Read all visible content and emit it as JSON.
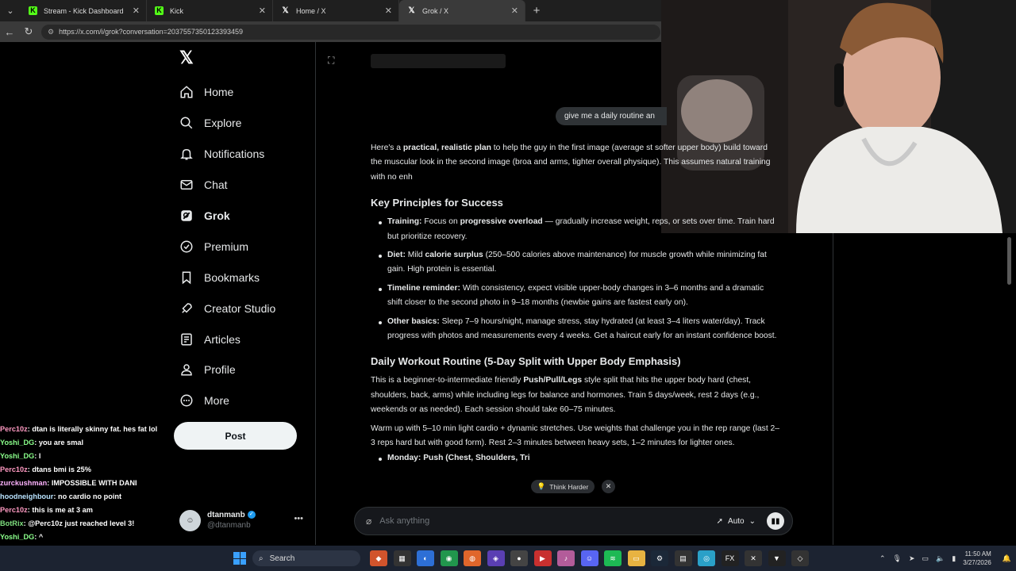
{
  "browser": {
    "tabs": [
      {
        "label": "Stream - Kick Dashboard",
        "icon": "kick-icon",
        "active": false
      },
      {
        "label": "Kick",
        "icon": "kick-icon",
        "active": false
      },
      {
        "label": "Home / X",
        "icon": "x-icon",
        "active": false
      },
      {
        "label": "Grok / X",
        "icon": "x-icon",
        "active": true
      }
    ],
    "url": "https://x.com/i/grok?conversation=2037557350123393459"
  },
  "sidebar": {
    "items": [
      {
        "label": "Home",
        "icon": "home-icon"
      },
      {
        "label": "Explore",
        "icon": "search-icon"
      },
      {
        "label": "Notifications",
        "icon": "bell-icon"
      },
      {
        "label": "Chat",
        "icon": "mail-icon"
      },
      {
        "label": "Grok",
        "icon": "grok-icon",
        "active": true
      },
      {
        "label": "Premium",
        "icon": "verified-icon"
      },
      {
        "label": "Bookmarks",
        "icon": "bookmark-icon"
      },
      {
        "label": "Creator Studio",
        "icon": "rocket-icon"
      },
      {
        "label": "Articles",
        "icon": "article-icon"
      },
      {
        "label": "Profile",
        "icon": "person-icon"
      },
      {
        "label": "More",
        "icon": "more-circle-icon"
      }
    ],
    "post_label": "Post",
    "profile": {
      "display_name": "dtanmanb",
      "handle": "@dtanmanb"
    }
  },
  "chat": [
    {
      "user": "Perc10z",
      "msg": ": dtan is literally skinny fat. hes fat lol"
    },
    {
      "user": "Yoshi_DG",
      "msg": ": you are smal"
    },
    {
      "user": "Yoshi_DG",
      "msg": ": l"
    },
    {
      "user": "Perc10z",
      "msg": ": dtans bmi is 25%"
    },
    {
      "user": "zurckushman",
      "msg": ": IMPOSSIBLE WITH DANI"
    },
    {
      "user": "hoodneighbour",
      "msg": ": no cardio no point"
    },
    {
      "user": "Perc10z",
      "msg": ": this is me at 3 am"
    },
    {
      "user": "BotRix",
      "msg": ": @Perc10z just reached level 3!"
    },
    {
      "user": "Yoshi_DG",
      "msg": ": ^"
    }
  ],
  "grok": {
    "user_message": "give me a daily routine an",
    "intro": {
      "pre": "Here's a ",
      "bold": "practical, realistic plan",
      "post": " to help the guy in the first image (average st softer upper body) build toward the muscular look in the second image (broa and arms, tighter overall physique). This assumes natural training with no enh"
    },
    "h1": "Key Principles for Success",
    "principles": [
      {
        "label": "Training:",
        "text1": " Focus on ",
        "bold2": "progressive overload",
        "text2": " — gradually increase weight, reps, or sets over time. Train hard but prioritize recovery."
      },
      {
        "label": "Diet:",
        "text1": " Mild ",
        "bold2": "calorie surplus",
        "text2": " (250–500 calories above maintenance) for muscle growth while minimizing fat gain. High protein is essential."
      },
      {
        "label": "Timeline reminder:",
        "text1": " With consistency, expect visible upper-body changes in 3–6 months and a dramatic shift closer to the second photo in 9–18 months (newbie gains are fastest early on).",
        "bold2": "",
        "text2": ""
      },
      {
        "label": "Other basics:",
        "text1": " Sleep 7–9 hours/night, manage stress, stay hydrated (at least 3–4 liters water/day). Track progress with photos and measurements every 4 weeks. Get a haircut early for an instant confidence boost.",
        "bold2": "",
        "text2": ""
      }
    ],
    "h2": "Daily Workout Routine (5-Day Split with Upper Body Emphasis)",
    "p1": {
      "pre": "This is a beginner-to-intermediate friendly ",
      "bold": "Push/Pull/Legs",
      "post": " style split that hits the upper body hard (chest, shoulders, back, arms) while including legs for balance and hormones. Train 5 days/week, rest 2 days (e.g., weekends or as needed). Each session should take 60–75 minutes."
    },
    "p2": "Warm up with 5–10 min light cardio + dynamic stretches. Use weights that challenge you in the rep range (last 2–3 reps hard but with good form). Rest 2–3 minutes between heavy sets, 1–2 minutes for lighter ones.",
    "monday": "Monday: Push (Chest, Shoulders, Tri",
    "think_harder": "Think Harder",
    "composer_placeholder": "Ask anything",
    "mode": "Auto"
  },
  "taskbar": {
    "search": "Search",
    "time": "11:50 AM",
    "date": "3/27/2026"
  }
}
